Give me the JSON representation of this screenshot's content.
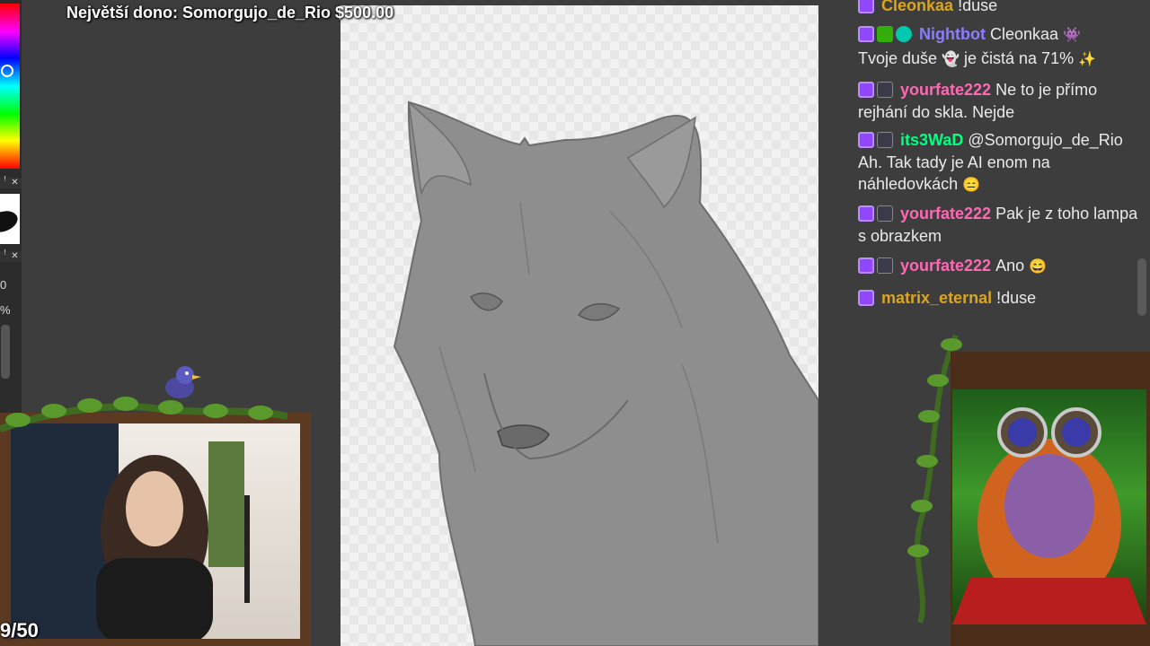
{
  "donation_banner": "Největší dono: Somorgujo_de_Rio $500.00",
  "left_panel": {
    "size_value": "0",
    "percent_value": "%",
    "panel_controls": [
      "ꜝ",
      "✕"
    ]
  },
  "chat": {
    "messages": [
      {
        "user": "Cleonkaa",
        "text": "!duse",
        "color": "yellow",
        "badges": [
          "sub"
        ]
      },
      {
        "user": "Nightbot",
        "text": "Cleonkaa",
        "text2": "Tvoje duše",
        "text3": "je čistá na 71%",
        "color": "purple",
        "badges": [
          "sub",
          "mod",
          "bot"
        ]
      },
      {
        "user": "yourfate222",
        "text": "Ne to je přímo rejhání do skla. Nejde",
        "color": "pink",
        "badges": [
          "sub",
          "gift"
        ]
      },
      {
        "user": "its3WaD",
        "text": "@Somorgujo_de_Rio Ah. Tak tady je AI enom na náhledovkách",
        "color": "green",
        "badges": [
          "sub",
          "gift"
        ]
      },
      {
        "user": "yourfate222",
        "text": "Pak je z toho lampa s obrazkem",
        "color": "pink",
        "badges": [
          "sub",
          "gift"
        ]
      },
      {
        "user": "yourfate222",
        "text": "Ano",
        "color": "pink",
        "badges": [
          "sub",
          "gift"
        ]
      },
      {
        "user": "matrix_eternal",
        "text": "!duse",
        "color": "yellow",
        "badges": [
          "sub"
        ]
      }
    ]
  },
  "counter": "9/50",
  "colors": {
    "background": "#3d3d3d",
    "yellow": "#daa520",
    "purple": "#8a7dff",
    "pink": "#ff69b4",
    "green": "#00ff7f",
    "frame_wood": "#5b3a21"
  }
}
